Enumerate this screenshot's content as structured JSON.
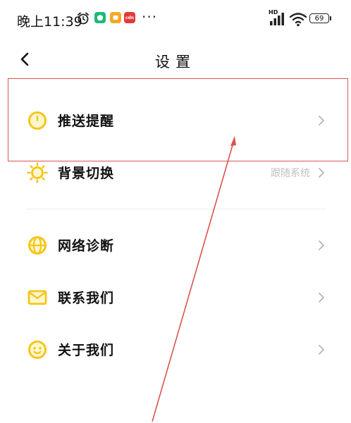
{
  "status_bar": {
    "time": "晚上11:39",
    "app_badge_3": "cdn",
    "dots": "···",
    "hd": "HD",
    "battery": "69"
  },
  "header": {
    "title": "设置"
  },
  "settings": {
    "items": [
      {
        "label": "推送提醒",
        "value": ""
      },
      {
        "label": "背景切换",
        "value": "跟随系统"
      },
      {
        "label": "网络诊断",
        "value": ""
      },
      {
        "label": "联系我们",
        "value": ""
      },
      {
        "label": "关于我们",
        "value": ""
      }
    ]
  },
  "colors": {
    "accent": "#f5c518",
    "annotation": "#d9534f"
  },
  "icons": [
    "alarm-icon",
    "back-icon",
    "bell-icon",
    "sun-icon",
    "globe-icon",
    "envelope-icon",
    "smiley-icon",
    "chevron-right-icon"
  ]
}
